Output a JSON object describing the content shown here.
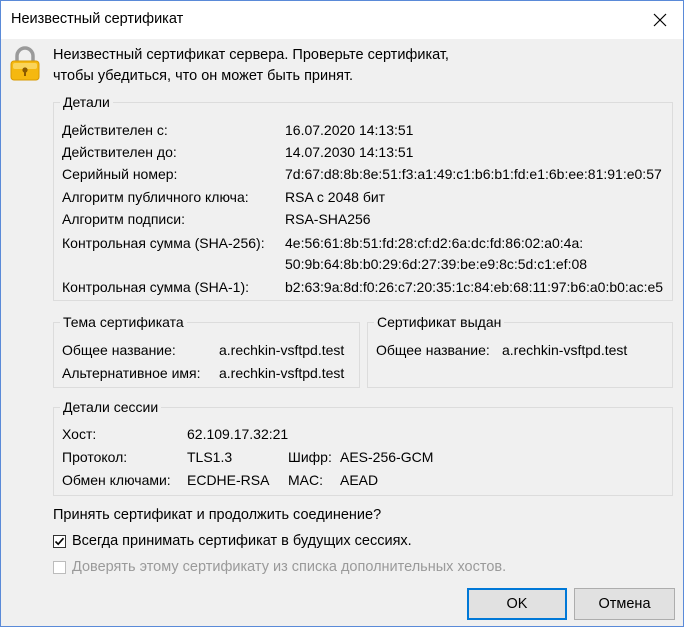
{
  "window": {
    "title": "Неизвестный сертификат"
  },
  "intro": {
    "line1": "Неизвестный сертификат сервера. Проверьте сертификат,",
    "line2": "чтобы убедиться, что он может быть принят."
  },
  "details": {
    "title": "Детали",
    "valid_from_label": "Действителен с:",
    "valid_from": "16.07.2020 14:13:51",
    "valid_to_label": "Действителен до:",
    "valid_to": "14.07.2030 14:13:51",
    "serial_label": "Серийный номер:",
    "serial": "7d:67:d8:8b:8e:51:f3:a1:49:c1:b6:b1:fd:e1:6b:ee:81:91:e0:57",
    "pubkey_label": "Алгоритм публичного ключа:",
    "pubkey": "RSA с 2048 бит",
    "sigalg_label": "Алгоритм подписи:",
    "sigalg": "RSA-SHA256",
    "sha256_label": "Контрольная сумма (SHA-256):",
    "sha256_line1": "4e:56:61:8b:51:fd:28:cf:d2:6a:dc:fd:86:02:a0:4a:",
    "sha256_line2": "50:9b:64:8b:b0:29:6d:27:39:be:e9:8c:5d:c1:ef:08",
    "sha1_label": "Контрольная сумма (SHA-1):",
    "sha1": "b2:63:9a:8d:f0:26:c7:20:35:1c:84:eb:68:11:97:b6:a0:b0:ac:e5"
  },
  "subject": {
    "title": "Тема сертификата",
    "cn_label": "Общее название:",
    "cn": "a.rechkin-vsftpd.test",
    "alt_label": "Альтернативное имя:",
    "alt": "a.rechkin-vsftpd.test"
  },
  "issuer": {
    "title": "Сертификат выдан",
    "cn_label": "Общее название:",
    "cn": "a.rechkin-vsftpd.test"
  },
  "session": {
    "title": "Детали сессии",
    "host_label": "Хост:",
    "host": "62.109.17.32:21",
    "protocol_label": "Протокол:",
    "protocol": "TLS1.3",
    "cipher_label": "Шифр:",
    "cipher": "AES-256-GCM",
    "kex_label": "Обмен ключами:",
    "kex": "ECDHE-RSA",
    "mac_label": "MAC:",
    "mac": "AEAD"
  },
  "question": "Принять сертификат и продолжить соединение?",
  "options": {
    "always_accept": "Всегда принимать сертификат в будущих сессиях.",
    "always_accept_checked": true,
    "trust_hosts": "Доверять этому сертификату из списка дополнительных хостов.",
    "trust_hosts_enabled": false
  },
  "buttons": {
    "ok": "OK",
    "cancel": "Отмена"
  },
  "colors": {
    "accent": "#0078d7",
    "lock_body": "#f5b80f",
    "lock_shackle": "#9a9a9a"
  }
}
